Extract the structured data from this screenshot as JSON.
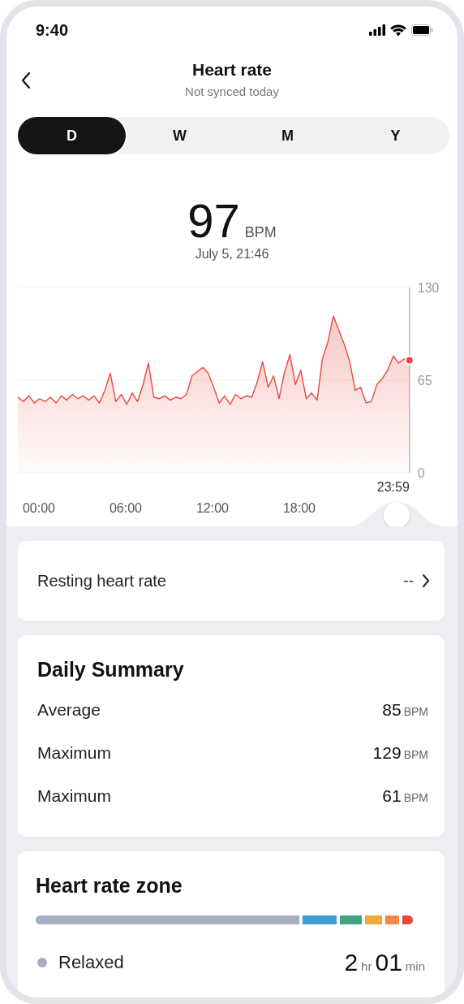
{
  "status_bar": {
    "time": "9:40"
  },
  "header": {
    "title": "Heart rate",
    "subtitle": "Not synced today"
  },
  "tabs": [
    {
      "label": "D",
      "selected": true
    },
    {
      "label": "W",
      "selected": false
    },
    {
      "label": "M",
      "selected": false
    },
    {
      "label": "Y",
      "selected": false
    }
  ],
  "reading": {
    "value": "97",
    "unit": "BPM",
    "time": "July 5, 21:46"
  },
  "chart": {
    "chart_data": {
      "type": "area",
      "x": [
        -87,
        -64,
        -42,
        -19,
        3,
        26,
        48,
        71,
        93,
        116,
        139,
        161,
        184,
        206,
        229,
        251,
        274,
        296,
        319,
        342,
        364,
        387,
        409,
        432,
        454,
        477,
        499,
        522,
        545,
        567,
        590,
        612,
        635,
        657,
        680,
        702,
        725,
        748,
        770,
        793,
        815,
        838,
        860,
        883,
        906,
        928,
        951,
        973,
        996,
        1018,
        1041,
        1064,
        1086,
        1109,
        1131,
        1154,
        1176,
        1199,
        1221,
        1244,
        1267,
        1289,
        1312,
        1334,
        1357,
        1379,
        1402,
        1424,
        1447,
        1470,
        1492,
        1515,
        1537
      ],
      "series": [
        {
          "color": "#e8483f",
          "values": [
            53,
            50,
            54,
            49,
            52,
            50,
            53,
            49,
            54,
            51,
            55,
            52,
            54,
            51,
            54,
            49,
            58,
            70,
            50,
            55,
            48,
            56,
            50,
            62,
            77,
            53,
            52,
            54,
            51,
            53,
            52,
            55,
            68,
            71,
            74,
            70,
            60,
            49,
            54,
            48,
            55,
            52,
            54,
            53,
            64,
            78,
            60,
            68,
            52,
            70,
            83,
            62,
            72,
            52,
            56,
            51,
            80,
            92,
            110,
            100,
            90,
            78,
            58,
            60,
            49,
            50,
            62,
            66,
            72,
            82,
            77,
            80,
            79
          ]
        }
      ],
      "xlim": [
        -87,
        1537
      ],
      "ylim": [
        0,
        130
      ],
      "yticks": [
        0,
        65,
        130
      ],
      "xticks": [
        {
          "value": 0,
          "label": "00:00"
        },
        {
          "value": 360,
          "label": "06:00"
        },
        {
          "value": 720,
          "label": "12:00"
        },
        {
          "value": 1080,
          "label": "18:00"
        }
      ]
    },
    "scrubber": {
      "time": "23:59"
    }
  },
  "resting": {
    "label": "Resting heart rate",
    "value": "--"
  },
  "summary": {
    "title": "Daily Summary",
    "rows": [
      {
        "label": "Average",
        "value": "85",
        "unit": "BPM"
      },
      {
        "label": "Maximum",
        "value": "129",
        "unit": "BPM"
      },
      {
        "label": "Maximum",
        "value": "61",
        "unit": "BPM"
      }
    ]
  },
  "zones": {
    "title": "Heart rate zone",
    "segments": [
      {
        "color": "#a9adc2"
      },
      {
        "color": "#3d9bd6"
      },
      {
        "color": "#3fa57f"
      },
      {
        "color": "#f2a93b"
      },
      {
        "color": "#ef8a45"
      },
      {
        "color": "#e6483f"
      }
    ],
    "legend": {
      "label": "Relaxed",
      "color": "#a9adc2",
      "hours": "2",
      "hours_unit": "hr",
      "minutes": "01",
      "minutes_unit": "min"
    }
  }
}
